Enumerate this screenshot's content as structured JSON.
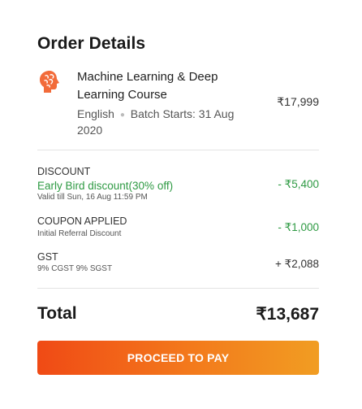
{
  "header": {
    "title": "Order Details"
  },
  "course": {
    "icon": "brain-icon",
    "name": "Machine Learning & Deep Learning Course",
    "language": "English",
    "batch": "Batch Starts: 31 Aug 2020",
    "price": "₹17,999"
  },
  "discount": {
    "label": "DISCOUNT",
    "offer": "Early Bird discount(30% off)",
    "validity": "Valid till Sun, 16 Aug 11:59 PM",
    "amount": "- ₹5,400"
  },
  "coupon": {
    "label": "COUPON APPLIED",
    "detail": "Initial Referral Discount",
    "amount": "- ₹1,000"
  },
  "gst": {
    "label": "GST",
    "detail": "9% CGST 9% SGST",
    "amount": "+ ₹2,088"
  },
  "total": {
    "label": "Total",
    "amount": "₹13,687"
  },
  "cta": {
    "label": "PROCEED TO PAY"
  },
  "colors": {
    "accent": "#f04a15",
    "success": "#2e9a43"
  }
}
